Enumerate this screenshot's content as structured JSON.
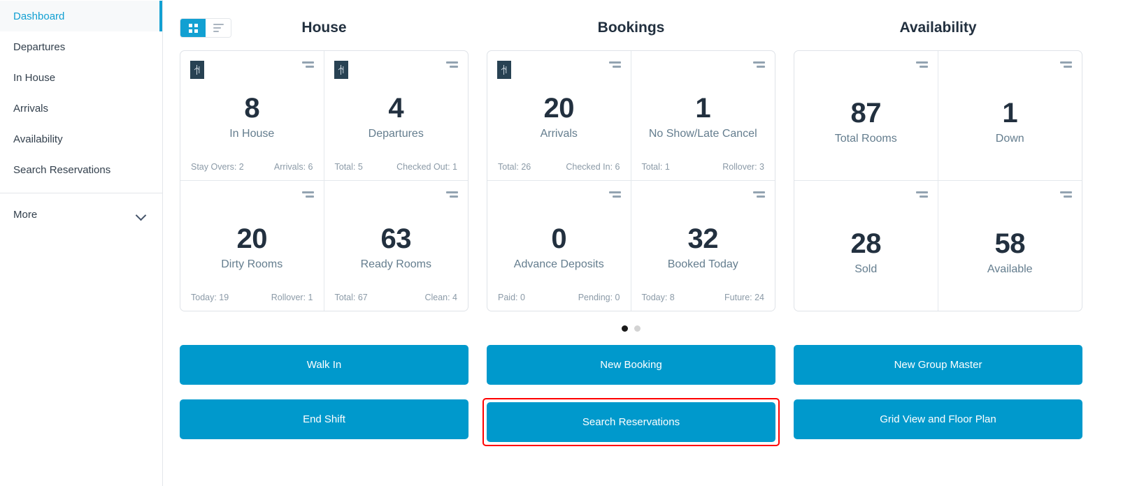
{
  "sidebar": {
    "items": [
      {
        "label": "Dashboard",
        "active": true
      },
      {
        "label": "Departures",
        "active": false
      },
      {
        "label": "In House",
        "active": false
      },
      {
        "label": "Arrivals",
        "active": false
      },
      {
        "label": "Availability",
        "active": false
      },
      {
        "label": "Search Reservations",
        "active": false
      }
    ],
    "more_label": "More"
  },
  "toolbar": {
    "grid_view_icon": "grid-view-icon",
    "list_view_icon": "list-view-icon",
    "active_view": "grid"
  },
  "colors": {
    "accent": "#0099cc",
    "accent_toggle": "#12a0d2",
    "value_text": "#22303f",
    "label_text": "#647d8e",
    "badge_bg": "#284253",
    "highlight": "#ff0000"
  },
  "columns": [
    {
      "header": "House",
      "cards": [
        {
          "value": "8",
          "label": "In House",
          "badge": true,
          "foot_left": "Stay Overs: 2",
          "foot_right": "Arrivals: 6"
        },
        {
          "value": "4",
          "label": "Departures",
          "badge": true,
          "foot_left": "Total: 5",
          "foot_right": "Checked Out: 1"
        },
        {
          "value": "20",
          "label": "Dirty Rooms",
          "badge": false,
          "foot_left": "Today: 19",
          "foot_right": "Rollover: 1"
        },
        {
          "value": "63",
          "label": "Ready Rooms",
          "badge": false,
          "foot_left": "Total: 67",
          "foot_right": "Clean: 4"
        }
      ]
    },
    {
      "header": "Bookings",
      "cards": [
        {
          "value": "20",
          "label": "Arrivals",
          "badge": true,
          "foot_left": "Total: 26",
          "foot_right": "Checked In: 6"
        },
        {
          "value": "1",
          "label": "No Show/Late Cancel",
          "badge": false,
          "foot_left": "Total: 1",
          "foot_right": "Rollover: 3"
        },
        {
          "value": "0",
          "label": "Advance Deposits",
          "badge": false,
          "foot_left": "Paid: 0",
          "foot_right": "Pending: 0"
        },
        {
          "value": "32",
          "label": "Booked Today",
          "badge": false,
          "foot_left": "Today: 8",
          "foot_right": "Future: 24"
        }
      ]
    },
    {
      "header": "Availability",
      "cards": [
        {
          "value": "87",
          "label": "Total Rooms",
          "badge": false,
          "foot_left": "",
          "foot_right": ""
        },
        {
          "value": "1",
          "label": "Down",
          "badge": false,
          "foot_left": "",
          "foot_right": ""
        },
        {
          "value": "28",
          "label": "Sold",
          "badge": false,
          "foot_left": "",
          "foot_right": ""
        },
        {
          "value": "58",
          "label": "Available",
          "badge": false,
          "foot_left": "",
          "foot_right": ""
        }
      ]
    }
  ],
  "carousel": {
    "total": 2,
    "active_index": 0
  },
  "actions": {
    "col1": [
      {
        "label": "Walk In",
        "highlighted": false
      },
      {
        "label": "End Shift",
        "highlighted": false
      }
    ],
    "col2": [
      {
        "label": "New Booking",
        "highlighted": false
      },
      {
        "label": "Search Reservations",
        "highlighted": true
      }
    ],
    "col3": [
      {
        "label": "New Group Master",
        "highlighted": false
      },
      {
        "label": "Grid View and Floor Plan",
        "highlighted": false
      }
    ]
  }
}
